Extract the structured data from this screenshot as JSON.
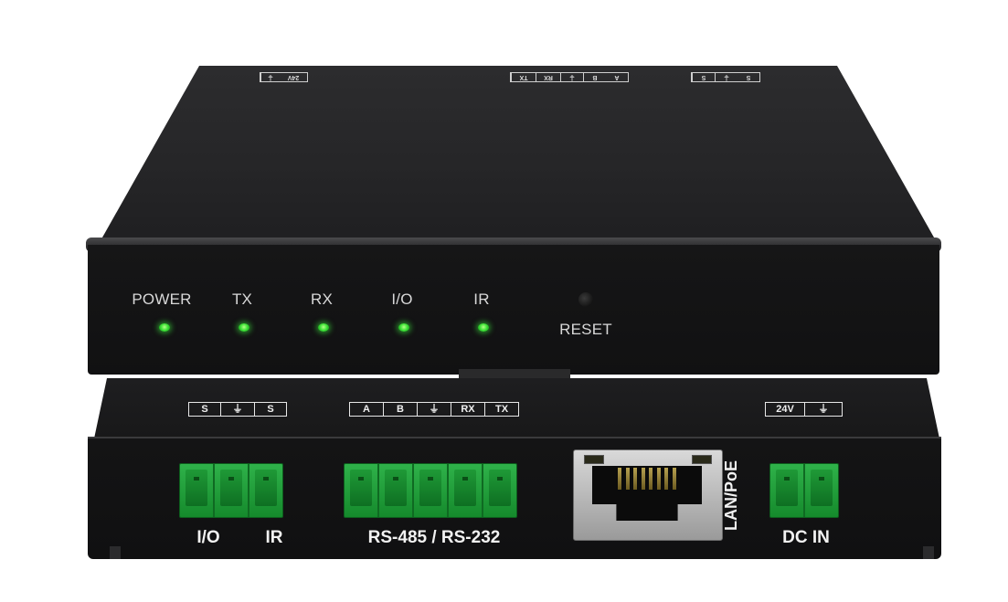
{
  "front_panel": {
    "leds": [
      {
        "label": "POWER"
      },
      {
        "label": "TX"
      },
      {
        "label": "RX"
      },
      {
        "label": "I/O"
      },
      {
        "label": "IR"
      }
    ],
    "reset_label": "RESET",
    "led_color": "#42e53a"
  },
  "top_silkscreen": {
    "power": [
      "24V",
      "⏚"
    ],
    "serial": [
      "TX",
      "RX",
      "⏚",
      "B",
      "A"
    ],
    "io_ir": [
      "S",
      "⏚",
      "S"
    ]
  },
  "rear_panel": {
    "io_ir_silk": [
      "S",
      "⏚",
      "S"
    ],
    "serial_silk": [
      "A",
      "B",
      "⏚",
      "RX",
      "TX"
    ],
    "power_silk": [
      "24V",
      "⏚"
    ],
    "labels": {
      "io": "I/O",
      "ir": "IR",
      "serial": "RS-485 / RS-232",
      "lan": "LAN/PoE",
      "dc_in": "DC IN"
    },
    "terminal_color": "#2fb24a"
  }
}
